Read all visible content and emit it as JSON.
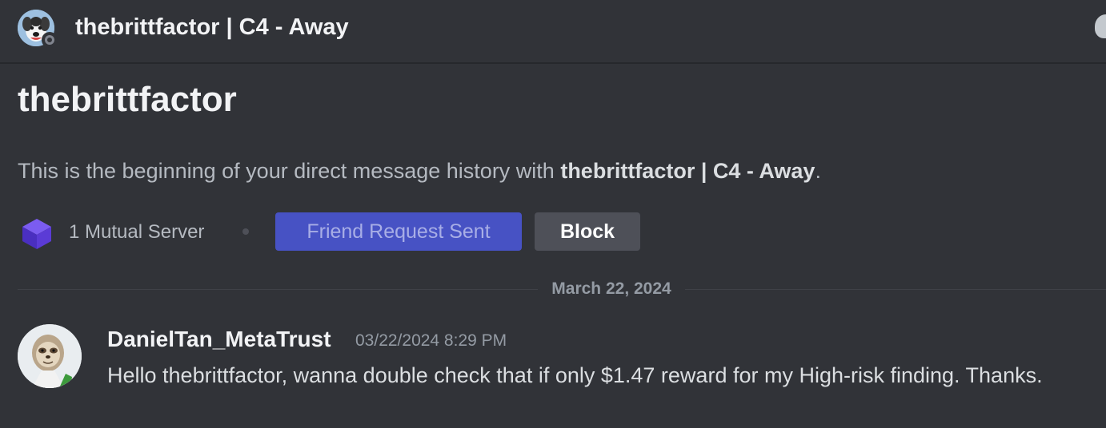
{
  "header": {
    "title": "thebrittfactor | C4 - Away",
    "status": "offline"
  },
  "intro": {
    "name": "thebrittfactor",
    "text_prefix": "This is the beginning of your direct message history with ",
    "text_bold": "thebrittfactor | C4 - Away",
    "text_suffix": "."
  },
  "mutual": {
    "label": "1 Mutual Server",
    "server_icon": "purple-cube-icon"
  },
  "buttons": {
    "friend_request": "Friend Request Sent",
    "block": "Block"
  },
  "divider": {
    "date": "March 22, 2024"
  },
  "message": {
    "author": "DanielTan_MetaTrust",
    "timestamp": "03/22/2024 8:29 PM",
    "content": "Hello thebrittfactor, wanna double check that if only $1.47 reward for my High-risk finding. Thanks."
  },
  "colors": {
    "background": "#313338",
    "friend_button": "#4752c4",
    "block_button": "#4e5058",
    "server_icon": "#5b3bd6"
  }
}
